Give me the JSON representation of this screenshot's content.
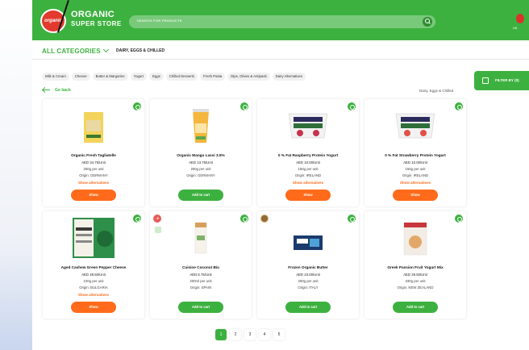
{
  "header": {
    "brand_line1": "ORGANIC",
    "brand_line2": "SUPER STORE",
    "search_placeholder": "SEARCH FOR PRODUCTS",
    "account_label": "UK"
  },
  "nav": {
    "all_categories": "ALL CATEGORIES",
    "active_category": "DAIRY, EGGS & CHILLED"
  },
  "filters": {
    "chips": [
      "Milk & Cream",
      "Cheese",
      "Butter & Margarine",
      "Yogurt",
      "Eggs",
      "Chilled Desserts",
      "Fresh Pasta",
      "Dips, Olives & Antipasti",
      "Dairy Alternatives"
    ],
    "filter_button": "FILTER BY (0)"
  },
  "page": {
    "back_label": "Go back",
    "breadcrumb": "Dairy, Eggs & Chilled"
  },
  "products": [
    {
      "name": "Organic Fresh Tagliatelle",
      "price": "AED 34.75/Unit",
      "unit": "250g per unit",
      "origin": "Origin: GERMANY",
      "alternatives": "Show alternatives",
      "button": "Show"
    },
    {
      "name": "Organic Mango Lassi 3.5%",
      "price": "AED 13.75/Unit",
      "unit": "250g per unit",
      "origin": "Origin: GERMANY",
      "alternatives": "",
      "button": "Add to cart"
    },
    {
      "name": "0 % Fat Raspberry Protein Yogurt",
      "price": "AED 10.00/Unit",
      "unit": "150g per unit",
      "origin": "Origin: IRELAND",
      "alternatives": "Show alternatives",
      "button": "Show"
    },
    {
      "name": "0 % Fat Strawberry Protein Yogurt",
      "price": "AED 10.00/Unit",
      "unit": "150g per unit",
      "origin": "Origin: IRELAND",
      "alternatives": "Show alternatives",
      "button": "Show"
    },
    {
      "name": "Aged Cashew Green Pepper Cheese",
      "price": "AED 48.50/Unit",
      "unit": "100g per unit",
      "origin": "Origin: BULGARIA",
      "alternatives": "Show alternatives",
      "button": "Show"
    },
    {
      "name": "Cuisine Coconut Bio",
      "price": "AED 6.75/Unit",
      "unit": "200ml per unit",
      "origin": "Origin: SPAIN",
      "alternatives": "",
      "button": "Add to cart",
      "badge": "-5"
    },
    {
      "name": "Frozen Organic Butter",
      "price": "AED 23.00/Unit",
      "unit": "250g per unit",
      "origin": "Origin: ITALY",
      "alternatives": "",
      "button": "Add to cart"
    },
    {
      "name": "Greek Passion Fruit Yogurt Mix",
      "price": "AED 29.50/Unit",
      "unit": "330g per unit",
      "origin": "Origin: NEW ZEALAND",
      "alternatives": "",
      "button": "Add to cart"
    }
  ],
  "pagination": [
    "1",
    "2",
    "3",
    "4",
    "5"
  ],
  "colors": {
    "brand_green": "#3db13f",
    "accent_orange": "#ff6b1a",
    "logo_red": "#e23a2e"
  }
}
